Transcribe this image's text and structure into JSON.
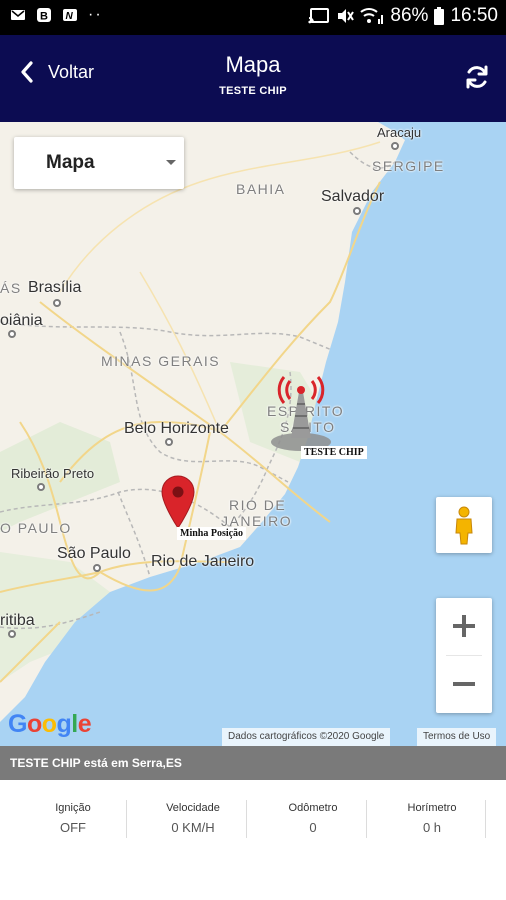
{
  "status_bar": {
    "battery": "86%",
    "time": "16:50"
  },
  "header": {
    "back_label": "Voltar",
    "title": "Mapa",
    "subtitle": "TESTE CHIP"
  },
  "map": {
    "type_selector": "Mapa",
    "labels": {
      "aracaju": "Aracaju",
      "sergipe": "SERGIPE",
      "bahia": "BAHIA",
      "salvador": "Salvador",
      "bahia_left": "ÁS",
      "brasilia": "Brasília",
      "goiania": "oiânia",
      "minas_gerais": "MINAS GERAIS",
      "espirito_santo_1": "ESPÍRITO",
      "espirito_santo_2": "SANTO",
      "belo_horizonte": "Belo Horizonte",
      "ribeirao_preto": "Ribeirão Preto",
      "rio_state_1": "RIO DE",
      "rio_state_2": "JANEIRO",
      "sp_state": "O PAULO",
      "sao_paulo": "São Paulo",
      "rio_city": "Rio de Janeiro",
      "curitiba": "ritiba"
    },
    "markers": {
      "device_label": "TESTE CHIP",
      "my_position_label": "Minha Posição"
    },
    "google_logo": "Google",
    "attribution": "Dados cartográficos ©2020 Google",
    "terms": "Termos de Uso",
    "zoom_in": "+",
    "zoom_out": "−"
  },
  "location_bar": "TESTE CHIP está em Serra,ES",
  "stats": [
    {
      "label": "Ignição",
      "value": "OFF"
    },
    {
      "label": "Velocidade",
      "value": "0 KM/H"
    },
    {
      "label": "Odômetro",
      "value": "0"
    },
    {
      "label": "Horímetro",
      "value": "0 h"
    }
  ],
  "colors": {
    "header_bg": "#0c0c52",
    "ocean": "#a9d3f3",
    "land": "#f4f1e9",
    "marker_red": "#d9242a",
    "location_bar": "#7a7a7a"
  }
}
